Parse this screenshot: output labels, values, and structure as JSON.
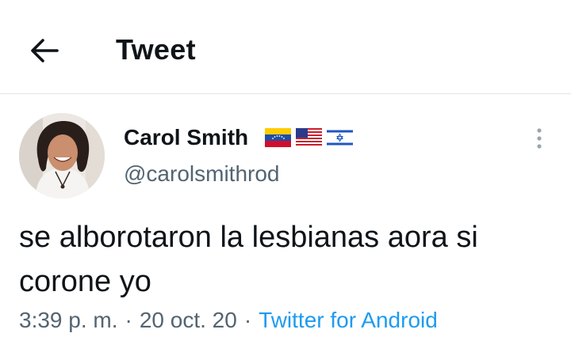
{
  "header": {
    "title": "Tweet",
    "back_icon": "arrow-left-icon"
  },
  "tweet": {
    "author": {
      "name": "Carol Smith",
      "handle": "@carolsmithrod",
      "flags": [
        "venezuela-flag-icon",
        "usa-flag-icon",
        "israel-flag-icon"
      ]
    },
    "text": "se alborotaron la lesbianas aora si corone yo",
    "time": "3:39 p. m.",
    "separator": "·",
    "date": "20 oct. 20",
    "source": "Twitter for Android",
    "more_icon": "more-vertical-icon"
  },
  "colors": {
    "text": "#0f1419",
    "secondary": "#536471",
    "link": "#1d9bf0",
    "divider": "#e1e6ea"
  }
}
